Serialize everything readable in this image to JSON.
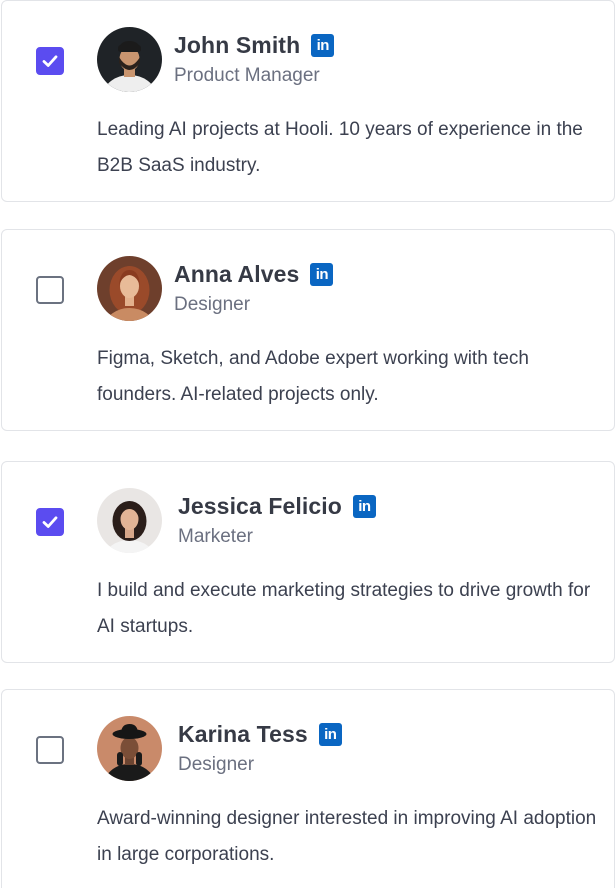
{
  "people": [
    {
      "name": "John Smith",
      "role": "Product Manager",
      "bio": "Leading AI projects at Hooli. 10 years of experience in the B2B SaaS industry.",
      "selected": true,
      "avatar_icon": "avatar-john-smith"
    },
    {
      "name": "Anna Alves",
      "role": "Designer",
      "bio": "Figma, Sketch, and Adobe expert working with tech founders. AI-related projects only.",
      "selected": false,
      "avatar_icon": "avatar-anna-alves"
    },
    {
      "name": "Jessica Felicio",
      "role": "Marketer",
      "bio": "I build and execute marketing strategies to drive growth for AI startups.",
      "selected": true,
      "avatar_icon": "avatar-jessica-felicio"
    },
    {
      "name": "Karina Tess",
      "role": "Designer",
      "bio": "Award-winning designer interested in improving AI adoption in large corporations.",
      "selected": false,
      "avatar_icon": "avatar-karina-tess"
    }
  ],
  "linkedin_label": "in",
  "colors": {
    "accent": "#5b4cf0",
    "linkedin": "#0a66c2",
    "border": "#e2e4e8"
  }
}
